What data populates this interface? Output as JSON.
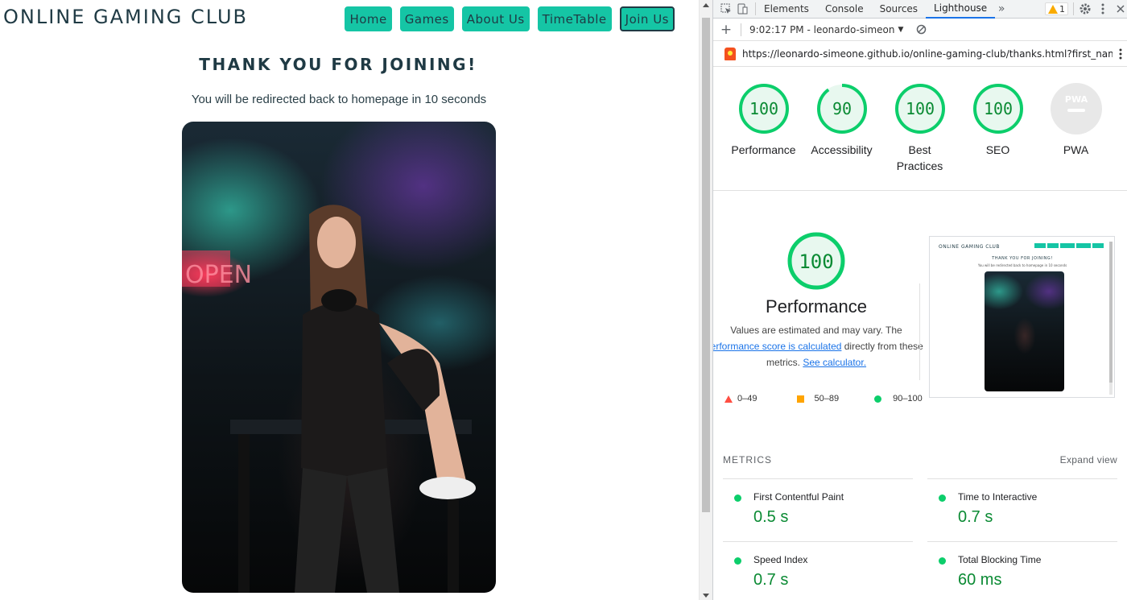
{
  "site": {
    "logo": "ONLINE GAMING CLUB",
    "nav": [
      "Home",
      "Games",
      "About Us",
      "TimeTable",
      "Join Us"
    ],
    "heading": "THANK YOU FOR JOINING!",
    "redirect_text": "You will be redirected back to homepage in 10 seconds"
  },
  "devtools": {
    "tabs": [
      "Elements",
      "Console",
      "Sources",
      "Lighthouse"
    ],
    "selected_tab": "Lighthouse",
    "more_tabs_icon": "»",
    "warning_count": "1",
    "report_time": "9:02:17 PM - leonardo-simeon",
    "url": "https://leonardo-simeone.github.io/online-gaming-club/thanks.html?first_name=Le...",
    "gauges": [
      {
        "score": "100",
        "label": "Performance",
        "value": 100
      },
      {
        "score": "90",
        "label": "Accessibility",
        "value": 90
      },
      {
        "score": "100",
        "label": "Best Practices",
        "value": 100
      },
      {
        "score": "100",
        "label": "SEO",
        "value": 100
      },
      {
        "score": "",
        "label": "PWA",
        "badge": "PWA",
        "value": 0
      }
    ],
    "performance": {
      "score": "100",
      "title": "Performance",
      "desc_line1": "Values are estimated and may vary. The",
      "link_text": "performance score is calculated",
      "desc_line2_rest": " directly from these",
      "desc_line3": "metrics.",
      "calculator_link": "See calculator."
    },
    "legend": [
      "0–49",
      "50–89",
      "90–100"
    ],
    "thumbnail": {
      "logo": "ONLINE GAMING CLUB",
      "heading": "THANK YOU FOR JOINING!",
      "sub": "You will be redirected back to homepage in 10 seconds"
    },
    "metrics_header": "METRICS",
    "expand_view": "Expand view",
    "metrics": [
      {
        "label": "First Contentful Paint",
        "value": "0.5 s"
      },
      {
        "label": "Time to Interactive",
        "value": "0.7 s"
      },
      {
        "label": "Speed Index",
        "value": "0.7 s"
      },
      {
        "label": "Total Blocking Time",
        "value": "60 ms"
      }
    ]
  },
  "colors": {
    "accent": "#15c5a5",
    "text_dark": "#1f3a44",
    "good": "#0cce6b",
    "good_text": "#0a8a33",
    "link": "#1a73e8"
  }
}
